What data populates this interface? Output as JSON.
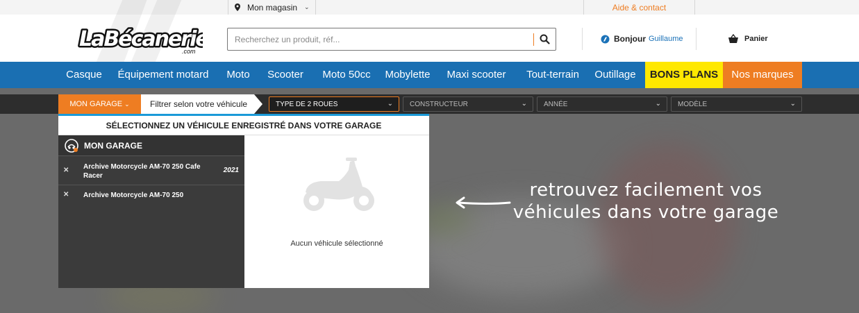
{
  "topbar": {
    "store_label": "Mon magasin",
    "help_label": "Aide & contact"
  },
  "header": {
    "logo_text": "LaBécanerie",
    "logo_sub": ".com",
    "search_placeholder": "Recherchez un produit, réf...",
    "greeting": "Bonjour",
    "user_name": "Guillaume",
    "cart_label": "Panier"
  },
  "nav": {
    "items": [
      "Casque",
      "Équipement motard",
      "Moto",
      "Scooter",
      "Moto 50cc",
      "Mobylette",
      "Maxi scooter",
      "Tout-terrain",
      "Outillage"
    ],
    "bons_plans": "BONS PLANS",
    "nos_marques": "Nos marques"
  },
  "filterbar": {
    "garage_button": "MON GARAGE",
    "filter_label": "Filtrer selon votre véhicule",
    "selects": [
      "TYPE DE 2 ROUES",
      "CONSTRUCTEUR",
      "ANNÉE",
      "MODÈLE"
    ]
  },
  "garage_panel": {
    "title": "SÉLECTIONNEZ UN VÉHICULE ENREGISTRÉ DANS VOTRE GARAGE",
    "sidebar_title": "MON GARAGE",
    "vehicles": [
      {
        "name": "Archive Motorcycle AM-70 250 Cafe Racer",
        "year": "2021"
      },
      {
        "name": "Archive Motorcycle AM-70 250",
        "year": ""
      }
    ],
    "empty_message": "Aucun véhicule sélectionné"
  },
  "callout": {
    "line1": "retrouvez facilement vos",
    "line2": "véhicules dans votre garage"
  },
  "colors": {
    "brand_blue": "#1a6fb2",
    "accent_orange": "#ee7d22",
    "bons_plans_yellow": "#ffe800",
    "overlay_gray": "#6a6a6a"
  }
}
